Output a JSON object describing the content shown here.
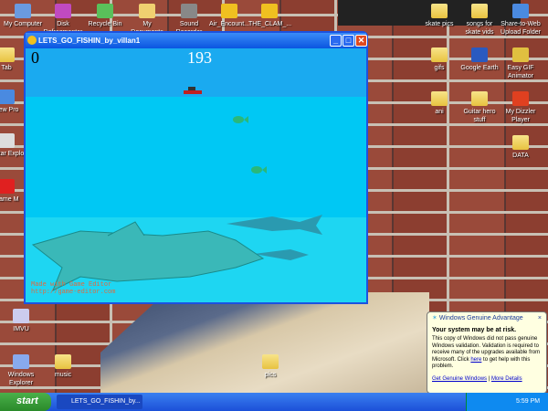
{
  "desktop": {
    "icons": [
      {
        "label": "My Computer"
      },
      {
        "label": "Disk Defragmenter"
      },
      {
        "label": "Recycle Bin"
      },
      {
        "label": "My Documents"
      },
      {
        "label": "Sound Recorder"
      },
      {
        "label": "Air_Encount..."
      },
      {
        "label": "THE_CLAM_..."
      },
      {
        "label": "skate pics"
      },
      {
        "label": "songs for skate vids"
      },
      {
        "label": "Share-to-Web Upload Folder"
      },
      {
        "label": "gifs"
      },
      {
        "label": "Google Earth"
      },
      {
        "label": "Easy GIF Animator"
      },
      {
        "label": "ani"
      },
      {
        "label": "Guitar hero stuff"
      },
      {
        "label": "My Dizzler Player"
      },
      {
        "label": "DATA"
      },
      {
        "label": "Tab"
      },
      {
        "label": "New Pro"
      },
      {
        "label": "Guitar Explo"
      },
      {
        "label": "Game M"
      },
      {
        "label": "IMVU"
      },
      {
        "label": "Windows Explorer"
      },
      {
        "label": "music"
      },
      {
        "label": "pics"
      }
    ]
  },
  "window": {
    "title": "LETS_GO_FISHIN_by_villan1",
    "minimize": "_",
    "maximize": "□",
    "close": "✕"
  },
  "game": {
    "score": "0",
    "timer": "193",
    "credit_line1": "Made with Game Editor",
    "credit_line2": "http://game-editor.com"
  },
  "taskbar": {
    "start": "start",
    "task": "LETS_GO_FISHIN_by...",
    "clock": "5:59 PM"
  },
  "balloon": {
    "title": "Windows Genuine Advantage",
    "close": "×",
    "heading": "Your system may be at risk.",
    "body1": "This copy of Windows did not pass genuine Windows validation. Validation is required to receive many of the upgrades available from Microsoft. Click ",
    "link_here": "here",
    "body2": " to get help with this problem.",
    "link1": "Get Genuine Windows",
    "sep": "|",
    "link2": "More Details"
  },
  "colors": {
    "sky": "#1aaaf0",
    "water": "#00c8f4",
    "titlebar": "#0a55e0"
  }
}
